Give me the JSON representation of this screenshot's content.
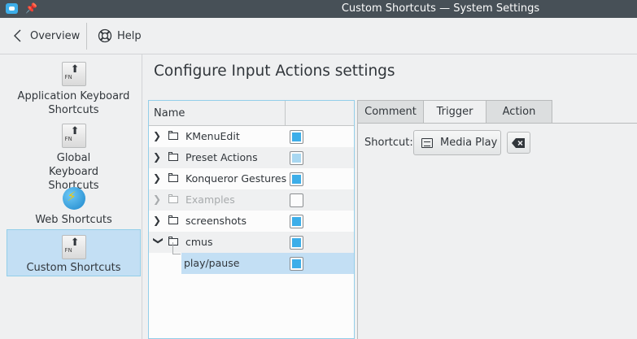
{
  "window": {
    "title": "Custom Shortcuts  — System Settings"
  },
  "toolbar": {
    "back_label": "Overview",
    "help_label": "Help"
  },
  "sidebar": {
    "items": [
      {
        "label": "Application Keyboard Shortcuts",
        "icon": "keyboard-key-icon",
        "selected": false
      },
      {
        "label": "Global Keyboard Shortcuts",
        "icon": "keyboard-key-icon",
        "selected": false
      },
      {
        "label": "Web Shortcuts",
        "icon": "globe-icon",
        "selected": false
      },
      {
        "label": "Custom Shortcuts",
        "icon": "keyboard-key-icon",
        "selected": true
      }
    ],
    "fn_text": "FN"
  },
  "main": {
    "heading": "Configure Input Actions settings",
    "tree": {
      "header_name": "Name",
      "rows": [
        {
          "label": "KMenuEdit",
          "enabled": true
        },
        {
          "label": "Preset Actions",
          "enabled": true,
          "partial": true
        },
        {
          "label": "Konqueror Gestures",
          "enabled": true
        },
        {
          "label": "Examples",
          "enabled": false
        },
        {
          "label": "screenshots",
          "enabled": true
        },
        {
          "label": "cmus",
          "enabled": true,
          "expanded": true
        },
        {
          "label": "play/pause",
          "enabled": true,
          "child": true,
          "selected": true
        }
      ]
    },
    "tabs": [
      {
        "label": "Comment",
        "active": false
      },
      {
        "label": "Trigger",
        "active": true
      },
      {
        "label": "Action",
        "active": false
      }
    ],
    "trigger": {
      "shortcut_label": "Shortcut:",
      "shortcut_value": "Media Play"
    }
  },
  "colors": {
    "accent": "#3daee9",
    "selection": "#c3dff4",
    "titlebar": "#475057"
  }
}
